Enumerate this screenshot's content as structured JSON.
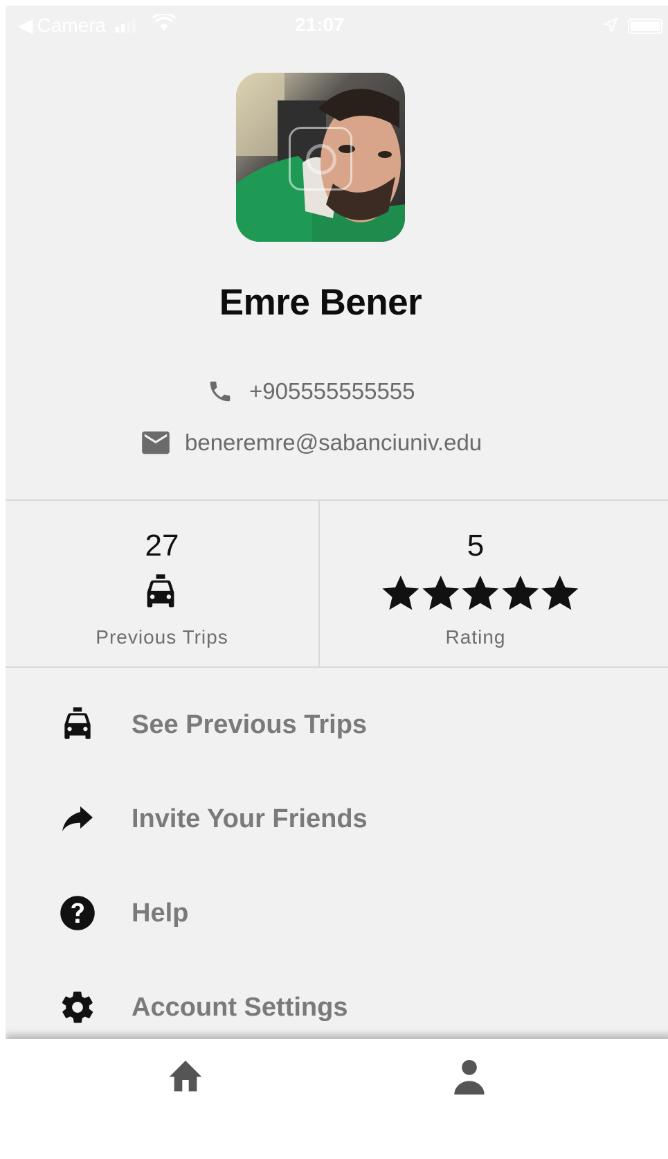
{
  "status_bar": {
    "back_label": "Camera",
    "time": "21:07"
  },
  "profile": {
    "name": "Emre Bener",
    "phone": "+905555555555",
    "email": "beneremre@sabanciuniv.edu"
  },
  "stats": {
    "trips": {
      "value": "27",
      "label": "Previous Trips",
      "icon": "taxi-icon"
    },
    "rating": {
      "value": "5",
      "label": "Rating",
      "stars": 5,
      "max_stars": 5
    }
  },
  "menu": {
    "items": [
      {
        "label": "See Previous Trips",
        "icon": "taxi-icon"
      },
      {
        "label": "Invite Your Friends",
        "icon": "share-icon"
      },
      {
        "label": "Help",
        "icon": "help-icon"
      },
      {
        "label": "Account Settings",
        "icon": "gear-icon"
      }
    ]
  },
  "bottom_nav": {
    "items": [
      {
        "icon": "home-icon"
      },
      {
        "icon": "person-icon"
      }
    ]
  },
  "colors": {
    "background": "#f1f1f1",
    "text_primary": "#0d0d0d",
    "text_secondary": "#6b6b6b",
    "divider": "#d9d9d9",
    "nav_icon": "#555555"
  }
}
